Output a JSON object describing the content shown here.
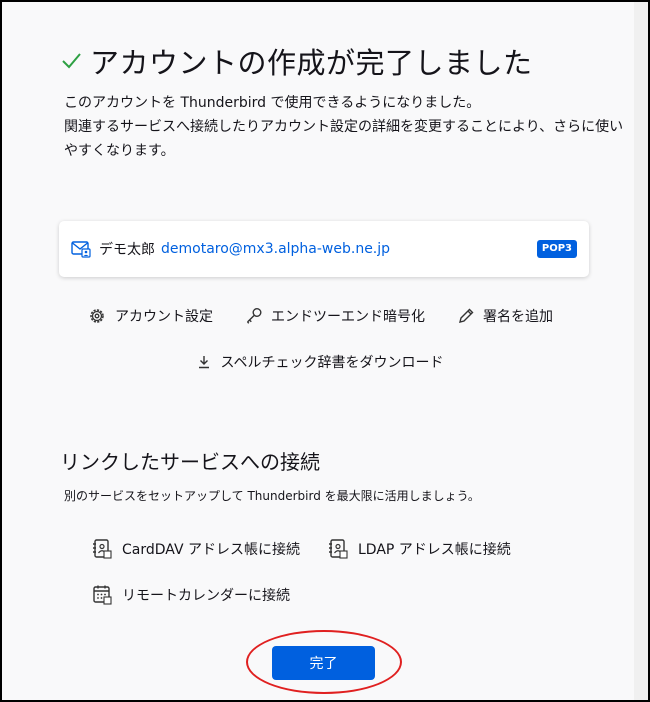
{
  "header": {
    "title": "アカウントの作成が完了しました",
    "check_icon": "checkmark-icon"
  },
  "intro": {
    "line1": "このアカウントを Thunderbird で使用できるようになりました。",
    "line2": "関連するサービスへ接続したりアカウント設定の詳細を変更することにより、さらに使い",
    "line3": "やすくなります。"
  },
  "account": {
    "icon": "mail-account-icon",
    "name": "デモ太郎",
    "email": "demotaro@mx3.alpha-web.ne.jp",
    "protocol": "POP3",
    "accent": "#0060df"
  },
  "actions": {
    "account_settings": "アカウント設定",
    "e2e_encryption": "エンドツーエンド暗号化",
    "add_signature": "署名を追加",
    "download_dictionary": "スペルチェック辞書をダウンロード"
  },
  "linked": {
    "title": "リンクしたサービスへの接続",
    "description": "別のサービスをセットアップして Thunderbird を最大限に活用しましょう。",
    "carddav": "CardDAV アドレス帳に接続",
    "ldap": "LDAP アドレス帳に接続",
    "calendar": "リモートカレンダーに接続"
  },
  "footer": {
    "done_label": "完了",
    "highlight_color": "#e02020"
  }
}
